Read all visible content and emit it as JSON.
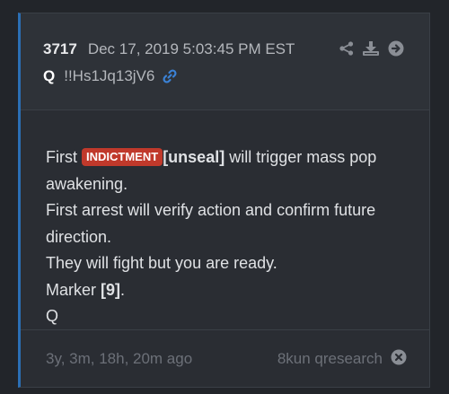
{
  "post": {
    "number": "3717",
    "timestamp": "Dec 17, 2019 5:03:45 PM EST",
    "author": "Q",
    "tripcode": "!!Hs1Jq13jV6"
  },
  "message": {
    "line1_prefix": "First",
    "badge": "INDICTMENT",
    "unseal": "[unseal]",
    "line1_suffix": "will trigger mass pop awakening.",
    "line2": "First arrest will verify action and confirm future direction.",
    "line3": "They will fight but you are ready.",
    "marker_prefix": "Marker",
    "marker_value": "[9]",
    "marker_suffix": ".",
    "signature": "Q"
  },
  "footer": {
    "age": "3y, 3m, 18h, 20m ago",
    "board": "8kun qresearch"
  },
  "icons": {
    "share": "share-icon",
    "download": "download-icon",
    "goto": "arrow-right-circle-icon",
    "link": "link-icon",
    "close": "close-circle-icon"
  },
  "colors": {
    "accent": "#2b6fb5",
    "badge": "#c0392b",
    "link": "#3b82d6"
  }
}
